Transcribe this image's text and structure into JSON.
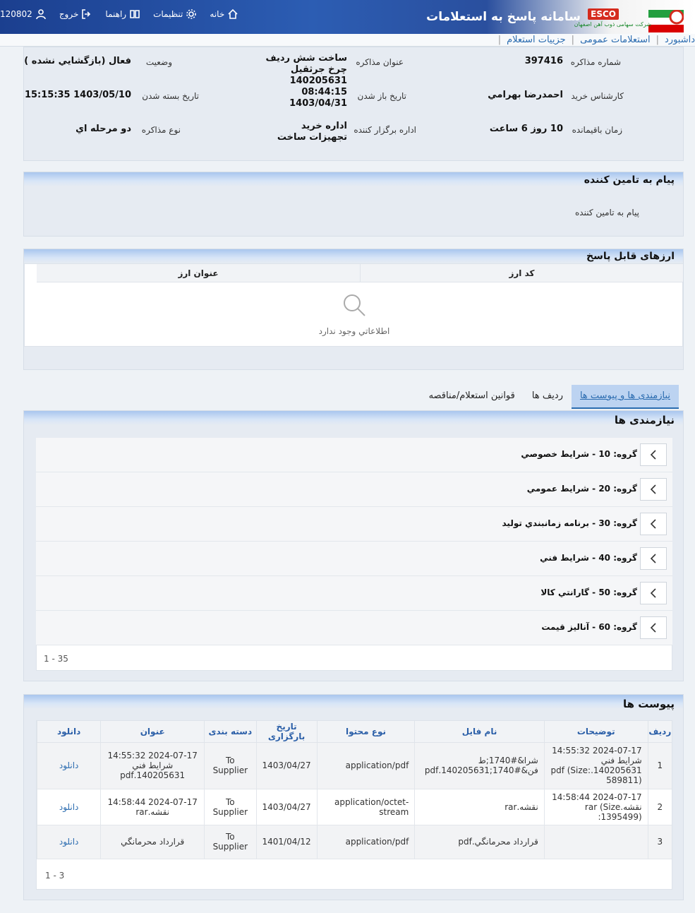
{
  "header": {
    "title": "سامانه پاسخ به استعلامات",
    "logo_badge": "ESCO",
    "logo_sub": "شرکت سهامی ذوب آهن اصفهان",
    "nav": {
      "home": "خانه",
      "settings": "تنظیمات",
      "help": "راهنما",
      "logout": "خروج",
      "user": "120802"
    }
  },
  "breadcrumb": {
    "items": [
      "داشبورد",
      "استعلامات عمومی",
      "جزییات استعلام"
    ]
  },
  "details": {
    "number_label": "شماره مذاکره",
    "number": "397416",
    "subject_label": "عنوان مذاکره",
    "subject": "ساخت شش رديف چرخ جرثقيل 140205631",
    "status_label": "وضعيت",
    "status": "فعال (بازگشايي نشده )",
    "buyer_label": "كارشناس خريد",
    "buyer": "احمدرضا بهرامي",
    "open_label": "تاريخ باز شدن",
    "open_time": "08:44:15",
    "open_date": "1403/04/31",
    "close_label": "تاريخ بسته شدن",
    "close": "1403/05/10 15:15:35",
    "remaining_label": "زمان باقيمانده",
    "remaining": "10 روز 6 ساعت",
    "office_label": "اداره برگزار كننده",
    "office": "اداره خريد تجهيزات ساخت",
    "type_label": "نوع مذاكره",
    "type": "دو مرحله اي"
  },
  "message": {
    "title": "پیام به تامین کننده",
    "text": "پیام به تامین کننده"
  },
  "currencies": {
    "title": "ارزهای قابل پاسخ",
    "col_code": "کد ارز",
    "col_title": "عنوان ارز",
    "empty": "اطلاعاتي وجود ندارد"
  },
  "tabs": {
    "items": [
      "نیازمندی ها و پیوست ها",
      "ردیف ها",
      "قوانین استعلام/مناقصه"
    ]
  },
  "needs": {
    "title": "نیازمندی ها",
    "groups": [
      "گروه: 10 - شرايط خصوصي",
      "گروه: 20 - شرايط عمومي",
      "گروه: 30 - برنامه زمانبندي توليد",
      "گروه: 40 - شرايط فني",
      "گروه: 50 - گارانتي كالا",
      "گروه: 60 - آناليز قيمت"
    ],
    "pager": "1 - 35"
  },
  "attachments": {
    "title": "پیوست ها",
    "columns": [
      "ردیف",
      "توضیحات",
      "نام فایل",
      "نوع محتوا",
      "تاریخ بارگزاری",
      "دسته بندی",
      "عنوان",
      "دانلود"
    ],
    "rows": [
      [
        "1",
        "2024-07-17 14:55:32 شرايط فني 140205631.pdf (Size: 589811)",
        "شرا&#1740;ط فن&#1740;140205631.pdf",
        "application/pdf",
        "1403/04/27",
        "To Supplier",
        "2024-07-17 14:55:32 شرايط فني 140205631.pdf",
        "دانلود"
      ],
      [
        "2",
        "2024-07-17 14:58:44 نقشه.rar (Size :1395499)",
        "نقشه.rar",
        "application/octet-stream",
        "1403/04/27",
        "To Supplier",
        "2024-07-17 14:58:44 نقشه.rar",
        "دانلود"
      ],
      [
        "3",
        "",
        "قرارداد محرمانگي.pdf",
        "application/pdf",
        "1401/04/12",
        "To Supplier",
        "قرارداد محرمانگي",
        "دانلود"
      ]
    ],
    "pager": "1 - 3"
  },
  "colors": {
    "accent": "#2b6cb0",
    "header_blue": "#1b3f8f"
  }
}
